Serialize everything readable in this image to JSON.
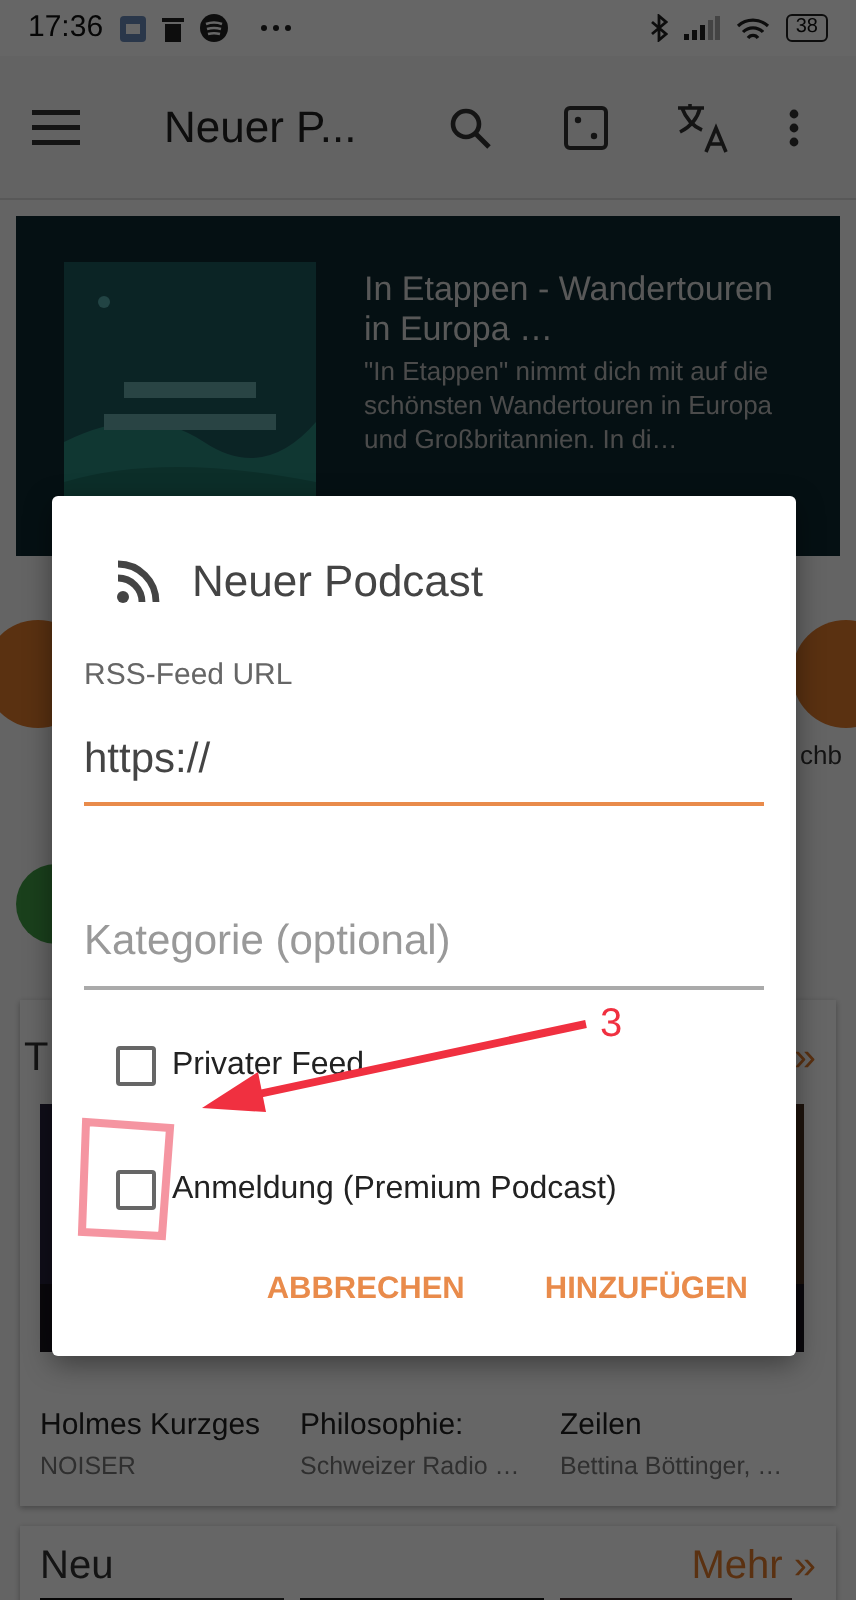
{
  "status_bar": {
    "time": "17:36",
    "battery": "38"
  },
  "app_bar": {
    "title": "Neuer P..."
  },
  "featured": {
    "title": "In Etappen - Wandertouren in Europa …",
    "description": "\"In Etappen\" nimmt dich mit auf die schönsten Wandertouren in Europa und Großbritannien. In di…"
  },
  "shortcuts": {
    "label": "chb"
  },
  "section": {
    "title": "T",
    "more": "»",
    "tiles": [
      {
        "title": "Holmes Kurzges",
        "author": "NOISER"
      },
      {
        "title": "Philosophie:",
        "author": "Schweizer Radio …"
      },
      {
        "title": "Zeilen",
        "author": "Bettina Böttinger, …"
      }
    ]
  },
  "section_new": {
    "title": "Neu",
    "more": "Mehr »"
  },
  "dialog": {
    "title": "Neuer Podcast",
    "url_label": "RSS-Feed URL",
    "url_value": "https://",
    "category_placeholder": "Kategorie (optional)",
    "checkboxes": [
      {
        "label": "Privater Feed",
        "checked": false
      },
      {
        "label": "Anmeldung (Premium Podcast)",
        "checked": false
      }
    ],
    "buttons": [
      "ABBRECHEN",
      "HINZUFÜGEN"
    ]
  },
  "annotation": {
    "number": "3"
  }
}
